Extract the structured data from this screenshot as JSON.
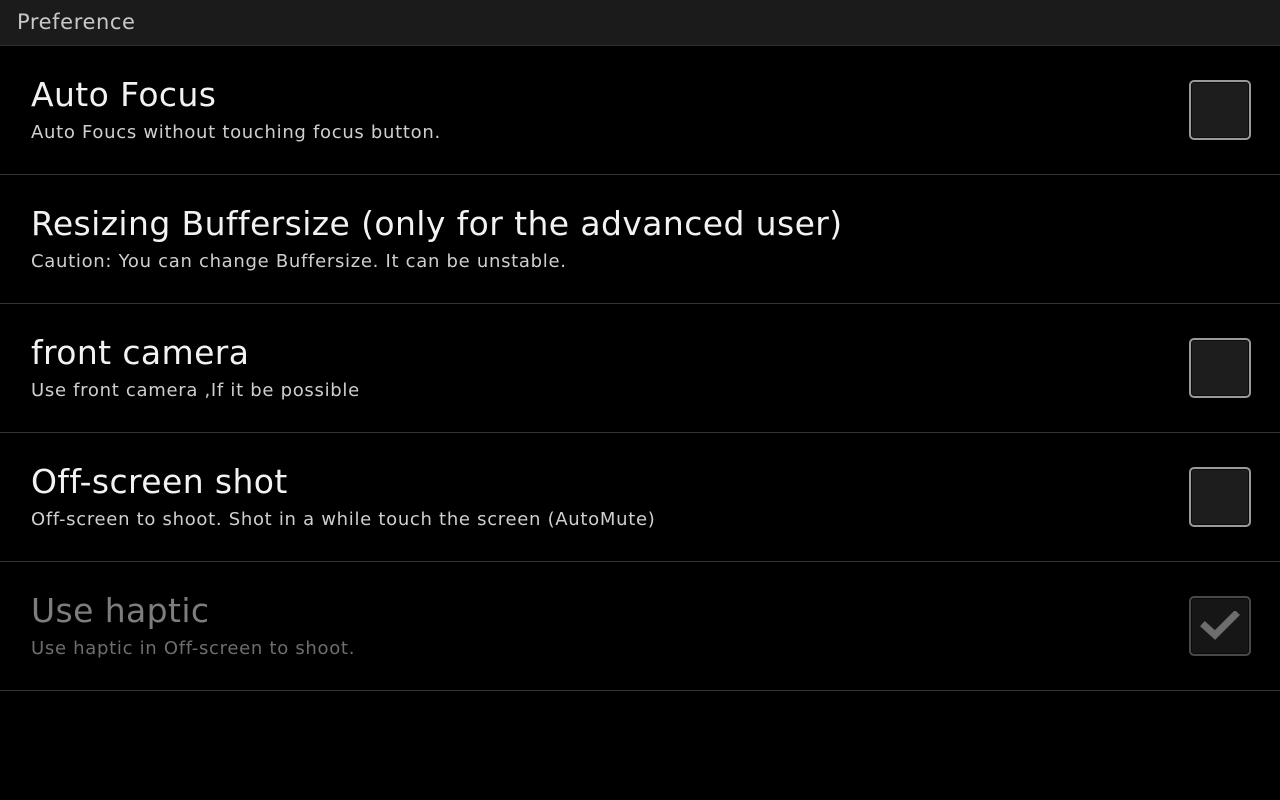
{
  "header": {
    "title": "Preference"
  },
  "preferences": {
    "rows": [
      {
        "title": "Auto Focus",
        "summary": "Auto Foucs without touching focus button.",
        "has_checkbox": true,
        "checked": false,
        "enabled": true
      },
      {
        "title": "Resizing Buffersize (only for the advanced user)",
        "summary": "Caution: You can change Buffersize. It can be unstable.",
        "has_checkbox": false,
        "checked": false,
        "enabled": true
      },
      {
        "title": "front camera",
        "summary": "Use front camera ,If it be possible",
        "has_checkbox": true,
        "checked": false,
        "enabled": true
      },
      {
        "title": "Off-screen shot",
        "summary": "Off-screen to shoot. Shot in a while touch the screen (AutoMute)",
        "has_checkbox": true,
        "checked": false,
        "enabled": true
      },
      {
        "title": "Use haptic",
        "summary": "Use haptic in Off-screen to shoot.",
        "has_checkbox": true,
        "checked": true,
        "enabled": false
      }
    ]
  },
  "colors": {
    "background": "#000000",
    "header_background": "#1b1b1b",
    "divider": "#343434",
    "title_text": "#f2f2f2",
    "summary_text": "#cfcfcf",
    "disabled_text": "#7d7d7d",
    "checkbox_border": "#9a9a9a",
    "checkbox_border_dim": "#494949",
    "checkmark": "#6d6d6d"
  },
  "icons": {
    "checkmark": "check-icon"
  }
}
